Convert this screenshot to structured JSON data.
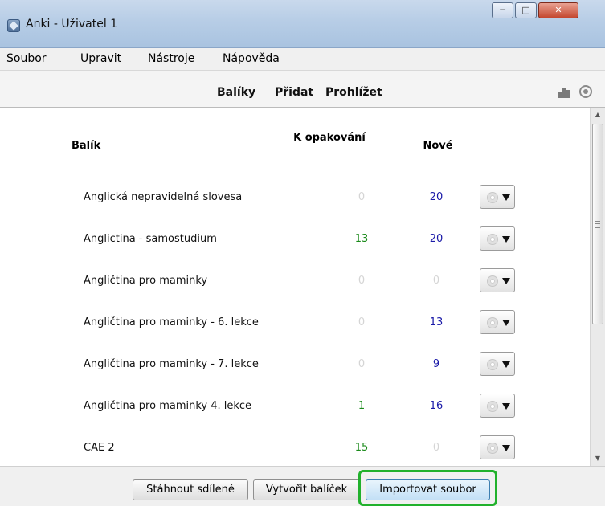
{
  "window": {
    "title": "Anki - Uživatel 1",
    "controls": [
      "minimize",
      "maximize",
      "close"
    ]
  },
  "menu": [
    "Soubor",
    "Upravit",
    "Nástroje",
    "Nápověda"
  ],
  "toolbar": {
    "links": [
      "Balíky",
      "Přidat",
      "Prohlížet"
    ],
    "icons": [
      "stats-icon",
      "sync-icon"
    ]
  },
  "table": {
    "headers": {
      "deck": "Balík",
      "due": "K opakování",
      "new": "Nové"
    },
    "rows": [
      {
        "name": "Anglická nepravidelná slovesa",
        "due": "0",
        "new": "20"
      },
      {
        "name": "Anglictina - samostudium",
        "due": "13",
        "new": "20"
      },
      {
        "name": "Angličtina pro maminky",
        "due": "0",
        "new": "0"
      },
      {
        "name": "Angličtina pro maminky - 6. lekce",
        "due": "0",
        "new": "13"
      },
      {
        "name": "Angličtina pro maminky - 7. lekce",
        "due": "0",
        "new": "9"
      },
      {
        "name": "Angličtina pro maminky 4. lekce",
        "due": "1",
        "new": "16"
      },
      {
        "name": "CAE 2",
        "due": "15",
        "new": "0"
      }
    ]
  },
  "bottom": {
    "share_label": "Stáhnout sdílené",
    "create_label": "Vytvořit balíček",
    "import_label": "Importovat soubor"
  },
  "colors": {
    "due_nonzero": "#1a8a1a",
    "new_nonzero": "#1a1aa8",
    "zero": "#d5d5d5",
    "highlight": "#21b12c"
  }
}
